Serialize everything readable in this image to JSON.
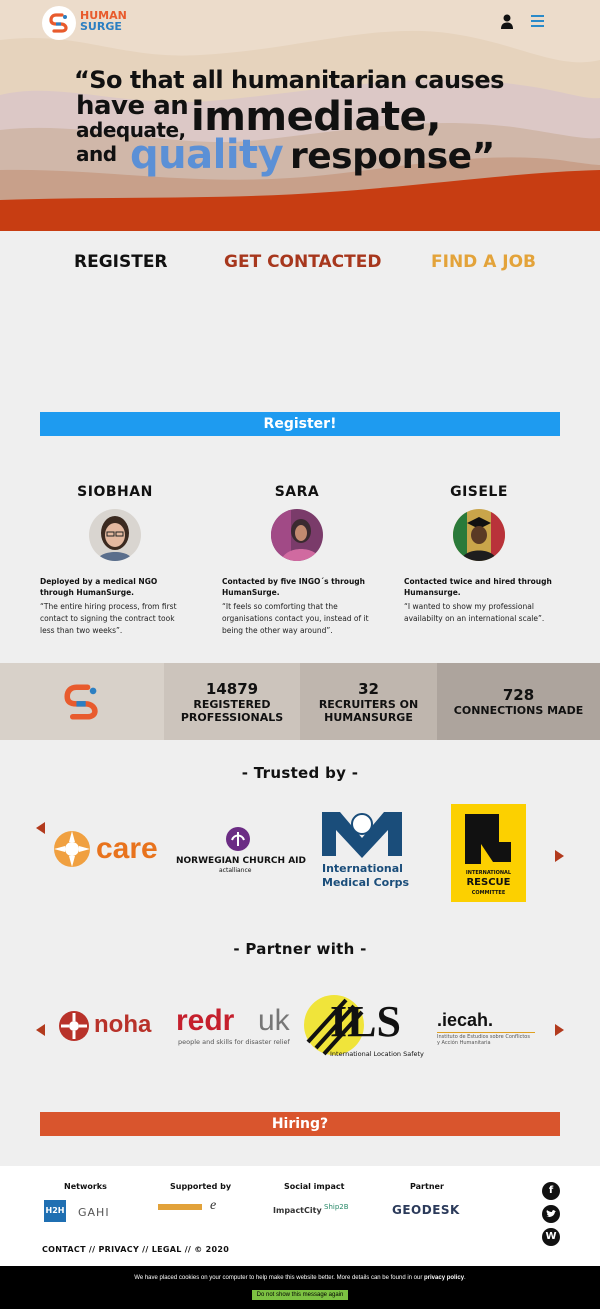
{
  "header": {
    "logo_text_1": "HUMAN",
    "logo_text_2": "SURGE",
    "icons": [
      "user-icon",
      "menu-icon"
    ]
  },
  "hero": {
    "quote_1": "“So that all humanitarian causes",
    "quote_2": "have an",
    "quote_big": "immediate,",
    "quote_3": "adequate,",
    "quote_4": "and",
    "quote_quality": "quality",
    "quote_response": "response”",
    "colors": {
      "sky": "#ecdccb",
      "layer1": "#e3cfb7",
      "layer2": "#d6c1c1",
      "layer3": "#c9a593",
      "accent": "#c73d12",
      "quality": "#5b90d6"
    }
  },
  "tabs": {
    "register": "REGISTER",
    "get_contacted": "GET CONTACTED",
    "find_job": "FIND A JOB"
  },
  "register_button": "Register!",
  "testimonials": [
    {
      "name": "SIOBHAN",
      "headline": "Deployed by a medical NGO through HumanSurge.",
      "text": "“The entire hiring process, from first contact to signing the contract took less than two weeks”."
    },
    {
      "name": "SARA",
      "headline": "Contacted by five INGO´s through HumanSurge.",
      "text": "“It feels so comforting that the organisations contact you, instead of it being the other way around”."
    },
    {
      "name": "GISELE",
      "headline": "Contacted twice and hired through Humansurge.",
      "text": "“I wanted to show my professional availabilty on an international scale”."
    }
  ],
  "stats": [
    {
      "number": "14879",
      "label_1": "REGISTERED",
      "label_2": "PROFESSIONALS"
    },
    {
      "number": "32",
      "label_1": "RECRUITERS ON",
      "label_2": "HUMANSURGE"
    },
    {
      "number": "728",
      "label_1": "CONNECTIONS MADE",
      "label_2": ""
    }
  ],
  "trusted": {
    "title": "- Trusted by -",
    "logos": {
      "care": "care",
      "nca_1": "NORWEGIAN CHURCH AID",
      "nca_2": "actalliance",
      "imc_1": "International",
      "imc_2": "Medical Corps",
      "irc_1": "INTERNATIONAL",
      "irc_2": "RESCUE",
      "irc_3": "COMMITTEE"
    }
  },
  "partner": {
    "title": "- Partner with -",
    "logos": {
      "noha": "noha",
      "redr_1": "redr",
      "redr_2": "uk",
      "redr_3": "people and skills for disaster relief",
      "ils_1": "ILS",
      "ils_2": "International Location Safety",
      "iecah_1": ".iecah.",
      "iecah_2": "Instituto de Estudios sobre Conflictos",
      "iecah_3": "y Acción Humanitaria"
    }
  },
  "hiring_button": "Hiring?",
  "footer": {
    "networks": "Networks",
    "supported_by": "Supported by",
    "social_impact": "Social impact",
    "partner": "Partner",
    "h2h": "H2H",
    "gahi": "GAHI",
    "impactcity": "ImpactCity",
    "ship2b": "Ship2B",
    "geodesk": "GEODESK",
    "links": {
      "contact": "CONTACT",
      "privacy": "PRIVACY",
      "legal": "LEGAL",
      "copyright": "© 2020"
    },
    "social": [
      "facebook-icon",
      "twitter-icon",
      "wordpress-icon"
    ]
  },
  "cookie": {
    "message": "We have placed cookies on your computer to help make this website better. More details can be found in our",
    "link": "privacy policy",
    "end": ".",
    "button": "Do not show this message again"
  }
}
